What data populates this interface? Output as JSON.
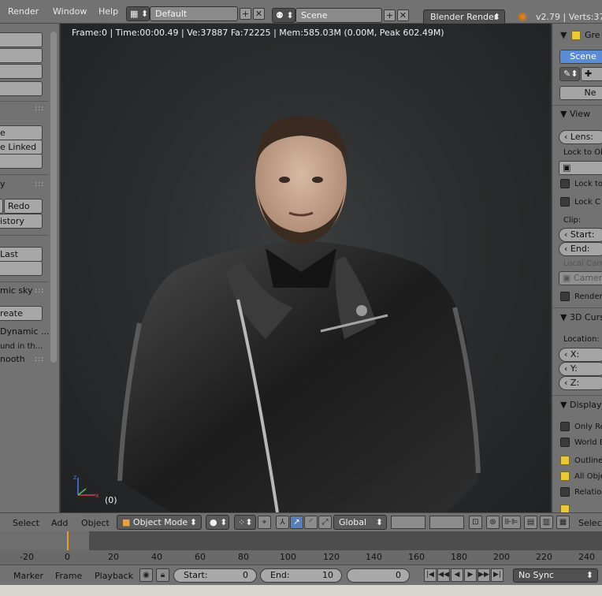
{
  "topbar": {
    "menus": [
      "Render",
      "Window",
      "Help"
    ],
    "layout_preset": "Default",
    "scene": "Scene",
    "render_engine": "Blender Render",
    "version_stats": "v2.79 | Verts:37,8"
  },
  "toolshelf": {
    "items": [
      "e",
      "e Linked",
      "y",
      "Redo",
      "istory",
      "Last",
      "mic sky",
      "reate",
      "Dynamic ...",
      "und in th...",
      "nooth"
    ]
  },
  "viewport": {
    "info": "Frame:0 | Time:00:00.49 | Ve:37887 Fa:72225 | Mem:585.03M (0.00M, Peak 602.49M)",
    "object_label": "(0)"
  },
  "properties": {
    "grease_title": "Gre",
    "scene_tab": "Scene",
    "new_button": "Ne",
    "view_panel": "View",
    "lens_label": "Lens:",
    "lock_to_object": "Lock to Ob",
    "lock_to_1": "Lock to",
    "lock_c": "Lock C",
    "clip_label": "Clip:",
    "clip_start": "Start:",
    "clip_end": "End:",
    "local_camera": "Local Cam",
    "camera_field": "Camera",
    "render_check": "Render",
    "cursor_panel": "3D Curs",
    "location_label": "Location:",
    "loc_x": "X:",
    "loc_y": "Y:",
    "loc_z": "Z:",
    "display_panel": "Display",
    "only_render": "Only Re",
    "world_background": "World B",
    "outline": "Outline",
    "all_objects": "All Obje",
    "relationship": "Relatio"
  },
  "view_header": {
    "menus": [
      "Select",
      "Add",
      "Object"
    ],
    "mode": "Object Mode",
    "orientation": "Global",
    "select_right": "Select"
  },
  "timeline": {
    "ticks": [
      "-20",
      "0",
      "20",
      "40",
      "60",
      "80",
      "100",
      "120",
      "140",
      "160",
      "180",
      "200",
      "220",
      "240"
    ],
    "current_frame_marker": 0
  },
  "timeline_header": {
    "menus": [
      "Marker",
      "Frame",
      "Playback"
    ],
    "start_label": "Start:",
    "start_value": "0",
    "end_label": "End:",
    "end_value": "10",
    "current_frame": "0",
    "sync": "No Sync"
  }
}
